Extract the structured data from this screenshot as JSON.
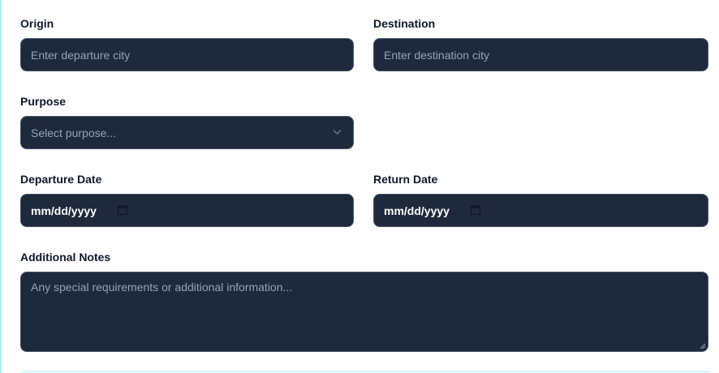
{
  "form": {
    "origin": {
      "label": "Origin",
      "placeholder": "Enter departure city"
    },
    "destination": {
      "label": "Destination",
      "placeholder": "Enter destination city"
    },
    "purpose": {
      "label": "Purpose",
      "placeholder": "Select purpose...",
      "icon": "chevron-down-icon"
    },
    "departure_date": {
      "label": "Departure Date",
      "value_text": "mm/dd/yyyy",
      "icon": "calendar-icon"
    },
    "return_date": {
      "label": "Return Date",
      "value_text": "mm/dd/yyyy",
      "icon": "calendar-icon"
    },
    "notes": {
      "label": "Additional Notes",
      "placeholder": "Any special requirements or additional information..."
    }
  },
  "colors": {
    "input_bg": "#1e293b",
    "input_border": "#475569",
    "placeholder": "#94a3b8",
    "label": "#0f172a",
    "accent_rule": "#a5f3fc"
  }
}
